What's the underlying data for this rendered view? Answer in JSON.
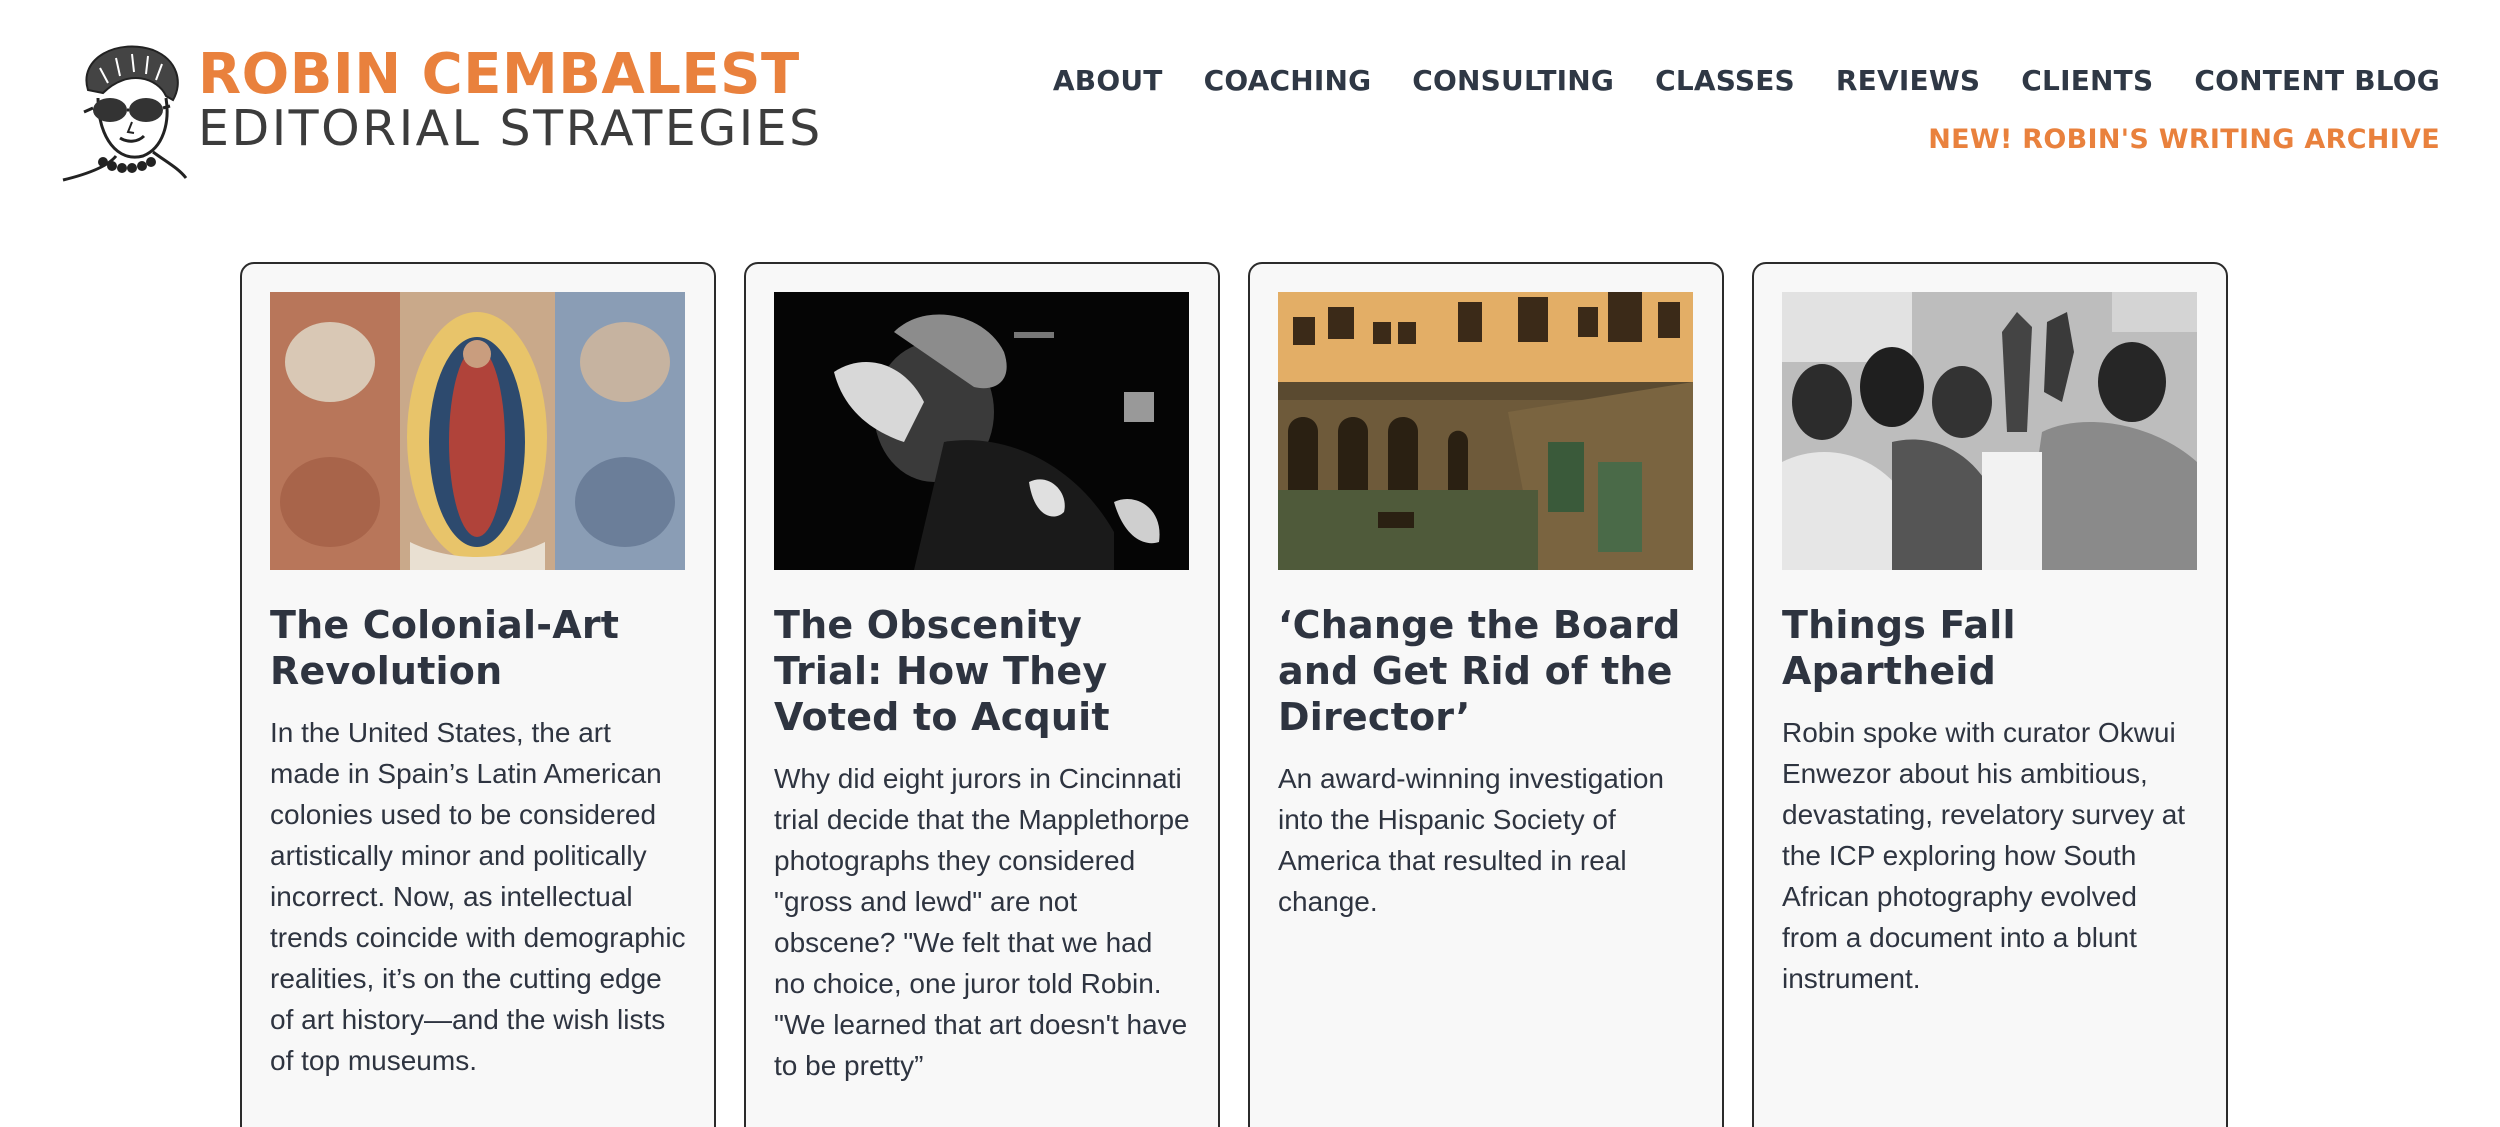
{
  "brand": {
    "name": "ROBIN CEMBALEST",
    "tagline": "EDITORIAL STRATEGIES"
  },
  "nav": {
    "items": [
      {
        "label": "ABOUT"
      },
      {
        "label": "COACHING"
      },
      {
        "label": "CONSULTING"
      },
      {
        "label": "CLASSES"
      },
      {
        "label": "REVIEWS"
      },
      {
        "label": "CLIENTS"
      },
      {
        "label": "CONTENT BLOG"
      }
    ],
    "archive_label": "NEW! ROBIN'S WRITING ARCHIVE"
  },
  "colors": {
    "accent": "#e9813d",
    "text": "#2e3440",
    "card_bg": "#f8f8f8",
    "card_border": "#2b2b2b"
  },
  "cards": [
    {
      "title": "The Colonial-Art Revolution",
      "description": "In the United States, the art made in Spain’s Latin American colonies used to be considered artistically minor and politically incorrect. Now, as intellectual trends coincide with demographic realities, it’s on the cutting edge of art history—and the wish lists of top museums."
    },
    {
      "title": "The Obscenity Trial: How They Voted to Acquit",
      "description": "Why did eight jurors in Cincinnati trial decide that the Mapplethorpe photographs they considered \"gross and lewd\" are not obscene? \"We felt that we had no choice, one juror told Robin. \"We learned that art doesn't have to be pretty”"
    },
    {
      "title": "‘Change the Board and Get Rid of the Director’",
      "description": "An award-winning investigation into the Hispanic Society of America that resulted in real change."
    },
    {
      "title": "Things Fall Apartheid",
      "description": "Robin spoke with curator Okwui Enwezor about his ambitious, devastating, revelatory survey at the ICP exploring how South African photography evolved from a document into a blunt instrument."
    }
  ]
}
